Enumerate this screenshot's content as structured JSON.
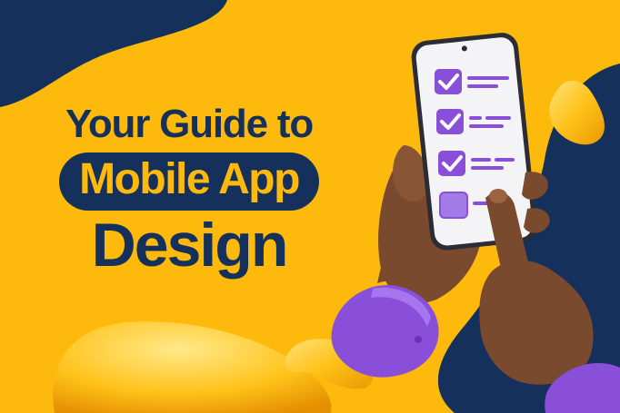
{
  "headline": {
    "line1": "Your Guide to",
    "line2": "Mobile App",
    "line3": "Design"
  },
  "colors": {
    "background": "#FDBA0C",
    "navy": "#15305A",
    "purple": "#8A4FD8",
    "skin": "#7A4A2E",
    "phone_screen": "#F4F4F7"
  },
  "checklist": {
    "items": [
      {
        "checked": true
      },
      {
        "checked": true
      },
      {
        "checked": true
      },
      {
        "checked": false
      }
    ]
  },
  "icons": [
    "check-icon",
    "blob-shape"
  ]
}
